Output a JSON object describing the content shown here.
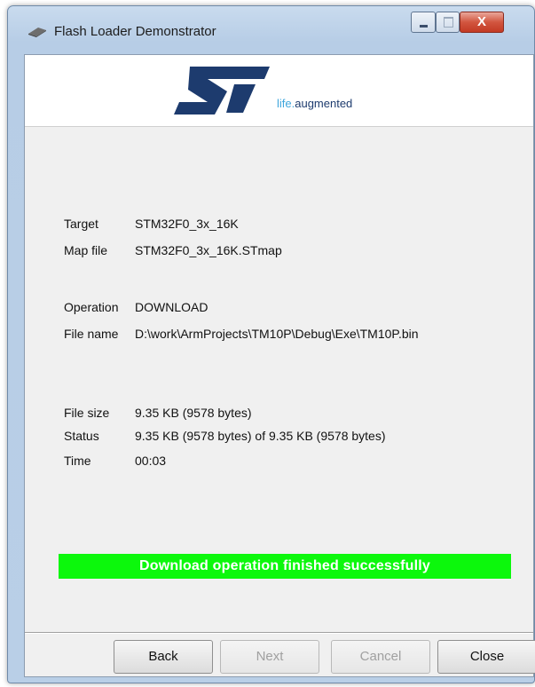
{
  "window": {
    "title": "Flash Loader Demonstrator",
    "controls": {
      "minimize": "–",
      "maximize": "□",
      "close": "X"
    }
  },
  "banner": {
    "logo": "st-logo",
    "tagline_life": "life.",
    "tagline_rest": "augmented"
  },
  "info": {
    "target_label": "Target",
    "target_value": "STM32F0_3x_16K",
    "mapfile_label": "Map file",
    "mapfile_value": "STM32F0_3x_16K.STmap",
    "operation_label": "Operation",
    "operation_value": "DOWNLOAD",
    "filename_label": "File name",
    "filename_value": "D:\\work\\ArmProjects\\TM10P\\Debug\\Exe\\TM10P.bin",
    "filesize_label": "File size",
    "filesize_value": "9.35 KB (9578 bytes)",
    "status_label": "Status",
    "status_value": "9.35 KB (9578 bytes) of 9.35 KB (9578 bytes)",
    "time_label": "Time",
    "time_value": "00:03"
  },
  "progress": {
    "message": "Download operation finished successfully",
    "fraction": 1.0,
    "color": "#0cf80c"
  },
  "buttons": {
    "back": "Back",
    "next": "Next",
    "cancel": "Cancel",
    "close": "Close"
  },
  "colors": {
    "st_blue": "#1d3b6e",
    "st_light_blue": "#3fa6dc"
  }
}
